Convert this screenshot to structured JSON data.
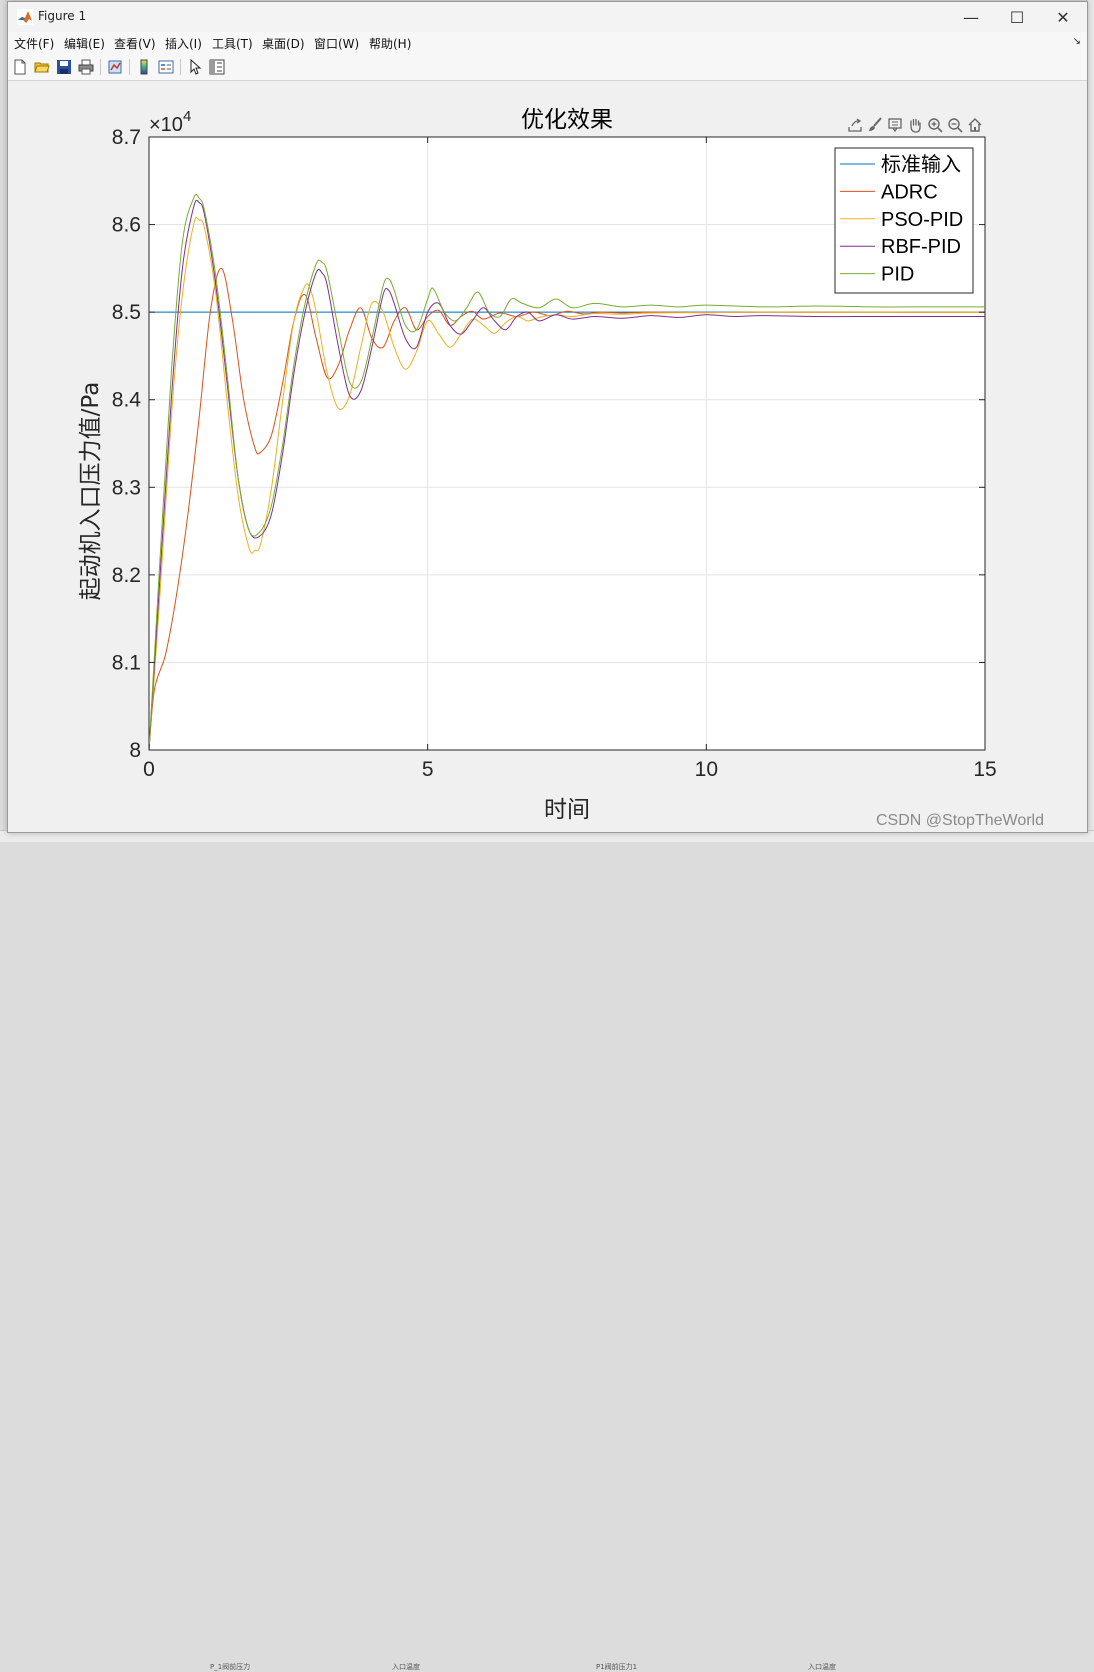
{
  "window": {
    "title": "Figure 1",
    "controls": {
      "minimize": "—",
      "maximize": "☐",
      "close": "✕"
    }
  },
  "menu": {
    "items": [
      "文件(F)",
      "编辑(E)",
      "查看(V)",
      "插入(I)",
      "工具(T)",
      "桌面(D)",
      "窗口(W)",
      "帮助(H)"
    ],
    "overflow_arrow": "↘"
  },
  "toolbar": {
    "buttons": [
      "new-figure-icon",
      "open-file-icon",
      "save-icon",
      "print-icon",
      "link-plot-icon",
      "colorbar-icon",
      "legend-icon",
      "pointer-icon",
      "property-inspector-icon"
    ]
  },
  "axes_toolbar": {
    "buttons": [
      "export-icon",
      "brush-icon",
      "datatip-icon",
      "pan-hand-icon",
      "zoom-in-icon",
      "zoom-out-icon",
      "home-icon"
    ]
  },
  "colors": {
    "标准输入": "#0072BD",
    "ADRC": "#D95319",
    "PSO-PID": "#EDB120",
    "RBF-PID": "#7E2F8E",
    "PID": "#77AC30"
  },
  "watermark": "CSDN @StopTheWorld",
  "background_labels": [
    "P_1阀前压力",
    "入口温度",
    "P1阀前压力1",
    "入口温度"
  ],
  "chart_data": {
    "type": "line",
    "title": "优化效果",
    "xlabel": "时间",
    "ylabel": "起动机入口压力值/Pa",
    "xlim": [
      0,
      15
    ],
    "ylim": [
      80000,
      87000
    ],
    "xticks": [
      "0",
      "5",
      "10",
      "15"
    ],
    "yticks": [
      "8",
      "8.1",
      "8.2",
      "8.3",
      "8.4",
      "8.5",
      "8.6",
      "8.7"
    ],
    "y_exponent_label": "×10",
    "y_exponent": "4",
    "grid": true,
    "legend_position": "top-right",
    "series": [
      {
        "name": "标准输入",
        "x": [
          0,
          15
        ],
        "y": [
          85000,
          85000
        ]
      },
      {
        "name": "ADRC",
        "x": [
          0,
          0.1,
          0.3,
          0.5,
          0.7,
          0.9,
          1.1,
          1.3,
          1.5,
          1.7,
          1.9,
          2.0,
          2.2,
          2.4,
          2.6,
          2.8,
          3.0,
          3.2,
          3.4,
          3.6,
          3.8,
          4.0,
          4.2,
          4.4,
          4.6,
          4.8,
          5.0,
          5.2,
          5.4,
          5.6,
          5.8,
          6.0,
          6.3,
          6.6,
          6.9,
          7.2,
          7.5,
          7.8,
          8.1,
          8.5,
          9.0,
          10.0,
          11.0,
          12.0,
          13.0,
          14.0,
          15.0
        ],
        "y": [
          80000,
          80700,
          81100,
          81800,
          82700,
          83800,
          85000,
          85500,
          84900,
          84000,
          83450,
          83400,
          83600,
          84200,
          84900,
          85200,
          84700,
          84250,
          84400,
          84800,
          85050,
          84700,
          84600,
          84900,
          85050,
          84800,
          84950,
          85020,
          84850,
          84950,
          85010,
          84920,
          84990,
          84950,
          85000,
          84960,
          85010,
          84980,
          85000,
          84990,
          85000,
          84995,
          85000,
          84998,
          85000,
          84998,
          85000
        ]
      },
      {
        "name": "PSO-PID",
        "x": [
          0,
          0.2,
          0.4,
          0.6,
          0.8,
          0.9,
          1.0,
          1.2,
          1.4,
          1.6,
          1.8,
          1.9,
          2.0,
          2.2,
          2.4,
          2.6,
          2.8,
          2.9,
          3.0,
          3.2,
          3.4,
          3.6,
          3.8,
          4.0,
          4.2,
          4.4,
          4.6,
          4.8,
          5.0,
          5.2,
          5.4,
          5.6,
          5.8,
          6.0,
          6.2,
          6.4,
          6.6,
          6.8,
          7.0,
          7.3,
          7.6,
          8.0,
          8.5,
          9.0,
          10.0,
          11.0,
          12.0,
          13.0,
          14.0,
          15.0
        ],
        "y": [
          80000,
          81800,
          83800,
          85200,
          86000,
          86050,
          85950,
          85200,
          84000,
          82900,
          82300,
          82280,
          82350,
          83000,
          84000,
          84900,
          85300,
          85250,
          85000,
          84300,
          83900,
          84050,
          84600,
          85100,
          85000,
          84600,
          84350,
          84550,
          84900,
          84750,
          84600,
          84750,
          84920,
          84850,
          84760,
          84880,
          84950,
          84900,
          84940,
          84970,
          84950,
          84985,
          84975,
          84990,
          84995,
          85000,
          84998,
          85000,
          84999,
          85000
        ]
      },
      {
        "name": "RBF-PID",
        "x": [
          0,
          0.2,
          0.4,
          0.6,
          0.8,
          0.9,
          1.0,
          1.2,
          1.4,
          1.6,
          1.8,
          2.0,
          2.2,
          2.4,
          2.6,
          2.8,
          3.0,
          3.1,
          3.2,
          3.4,
          3.6,
          3.8,
          4.0,
          4.2,
          4.3,
          4.4,
          4.6,
          4.8,
          5.0,
          5.2,
          5.4,
          5.6,
          5.8,
          6.0,
          6.2,
          6.4,
          6.6,
          6.8,
          7.0,
          7.3,
          7.6,
          8.0,
          8.5,
          9.0,
          9.5,
          10.0,
          10.5,
          11.0,
          12.0,
          13.0,
          14.0,
          15.0
        ],
        "y": [
          80000,
          82000,
          84000,
          85500,
          86200,
          86250,
          86100,
          85300,
          84200,
          83100,
          82500,
          82450,
          82700,
          83400,
          84300,
          85000,
          85450,
          85450,
          85300,
          84600,
          84050,
          84100,
          84600,
          85200,
          85250,
          85100,
          84700,
          84600,
          85000,
          85100,
          84850,
          84750,
          84900,
          85050,
          84900,
          84800,
          84950,
          85000,
          84900,
          84970,
          84920,
          84950,
          84930,
          84960,
          84940,
          84970,
          84950,
          84960,
          84950,
          84950,
          84950,
          84950
        ]
      },
      {
        "name": "PID",
        "x": [
          0,
          0.2,
          0.4,
          0.6,
          0.8,
          0.9,
          1.0,
          1.2,
          1.4,
          1.6,
          1.8,
          2.0,
          2.2,
          2.4,
          2.6,
          2.8,
          3.0,
          3.1,
          3.2,
          3.4,
          3.6,
          3.8,
          4.0,
          4.2,
          4.3,
          4.4,
          4.6,
          4.8,
          5.0,
          5.1,
          5.3,
          5.5,
          5.7,
          5.9,
          6.1,
          6.3,
          6.5,
          6.7,
          7.0,
          7.3,
          7.6,
          8.0,
          8.5,
          9.0,
          9.5,
          10.0,
          11.0,
          12.0,
          13.0,
          14.0,
          15.0
        ],
        "y": [
          80000,
          82200,
          84300,
          85800,
          86300,
          86300,
          86150,
          85400,
          84300,
          83100,
          82500,
          82500,
          82800,
          83500,
          84400,
          85100,
          85550,
          85570,
          85450,
          84800,
          84200,
          84200,
          84700,
          85300,
          85380,
          85250,
          84850,
          84800,
          85150,
          85270,
          85000,
          84900,
          85050,
          85230,
          85000,
          84950,
          85150,
          85100,
          85050,
          85150,
          85050,
          85100,
          85060,
          85080,
          85060,
          85080,
          85060,
          85070,
          85060,
          85060,
          85060
        ]
      }
    ]
  }
}
